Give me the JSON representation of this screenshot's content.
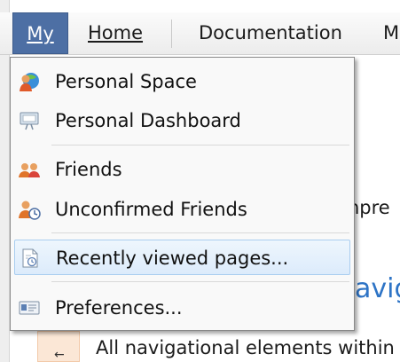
{
  "menubar": {
    "my_label": "My",
    "home_label": "Home",
    "documentation_label": "Documentation",
    "overflow_label": "M"
  },
  "dropdown": {
    "items": [
      {
        "label": "Personal Space",
        "icon": "personal-space-icon"
      },
      {
        "label": "Personal Dashboard",
        "icon": "dashboard-icon"
      },
      {
        "label": "Friends",
        "icon": "friends-icon"
      },
      {
        "label": "Unconfirmed Friends",
        "icon": "unconfirmed-friends-icon"
      },
      {
        "label": "Recently viewed pages...",
        "icon": "recent-pages-icon",
        "active": true
      },
      {
        "label": "Preferences...",
        "icon": "preferences-icon"
      }
    ]
  },
  "background": {
    "clipped_word_1": "npre",
    "clipped_link": "avig",
    "body_sentence": "All navigational elements within",
    "side_glyph": "←"
  },
  "colors": {
    "menubar_active": "#4d6fa4",
    "hover_highlight": "#dcebfb",
    "link_blue": "#2e74c6"
  }
}
